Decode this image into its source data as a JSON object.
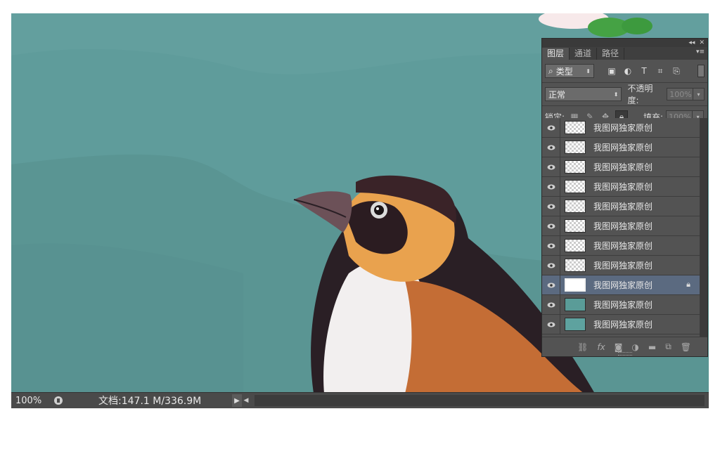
{
  "status_bar": {
    "zoom": "100%",
    "doc_info": "文档:147.1 M/336.9M"
  },
  "layers_panel": {
    "tabs": [
      {
        "label": "图层",
        "active": true
      },
      {
        "label": "通道",
        "active": false
      },
      {
        "label": "路径",
        "active": false
      }
    ],
    "filter": {
      "label": "类型"
    },
    "blend_mode": "正常",
    "opacity_label": "不透明度:",
    "opacity_value": "100%",
    "lock_label": "锁定:",
    "fill_label": "填充:",
    "fill_value": "100%",
    "layers": [
      {
        "name": "我图网独家原创",
        "thumb": "transparent",
        "selected": false,
        "locked": false
      },
      {
        "name": "我图网独家原创",
        "thumb": "transparent",
        "selected": false,
        "locked": false
      },
      {
        "name": "我图网独家原创",
        "thumb": "transparent",
        "selected": false,
        "locked": false
      },
      {
        "name": "我图网独家原创",
        "thumb": "transparent",
        "selected": false,
        "locked": false
      },
      {
        "name": "我图网独家原创",
        "thumb": "transparent",
        "selected": false,
        "locked": false
      },
      {
        "name": "我图网独家原创",
        "thumb": "transparent",
        "selected": false,
        "locked": false
      },
      {
        "name": "我图网独家原创",
        "thumb": "transparent",
        "selected": false,
        "locked": false
      },
      {
        "name": "我图网独家原创",
        "thumb": "transparent",
        "selected": false,
        "locked": false
      },
      {
        "name": "我图网独家原创",
        "thumb": "sketch",
        "selected": true,
        "locked": true
      },
      {
        "name": "我图网独家原创",
        "thumb": "teal-dark",
        "selected": false,
        "locked": false
      },
      {
        "name": "我图网独家原创",
        "thumb": "teal",
        "selected": false,
        "locked": false
      }
    ],
    "bottom_icons": [
      "link-icon",
      "fx-icon",
      "mask-icon",
      "adjustment-icon",
      "folder-icon",
      "new-layer-icon",
      "trash-icon"
    ]
  },
  "colors": {
    "canvas_bg": "#5f9c9b",
    "panel_bg": "#535353",
    "selected_layer": "#5b6a80"
  }
}
